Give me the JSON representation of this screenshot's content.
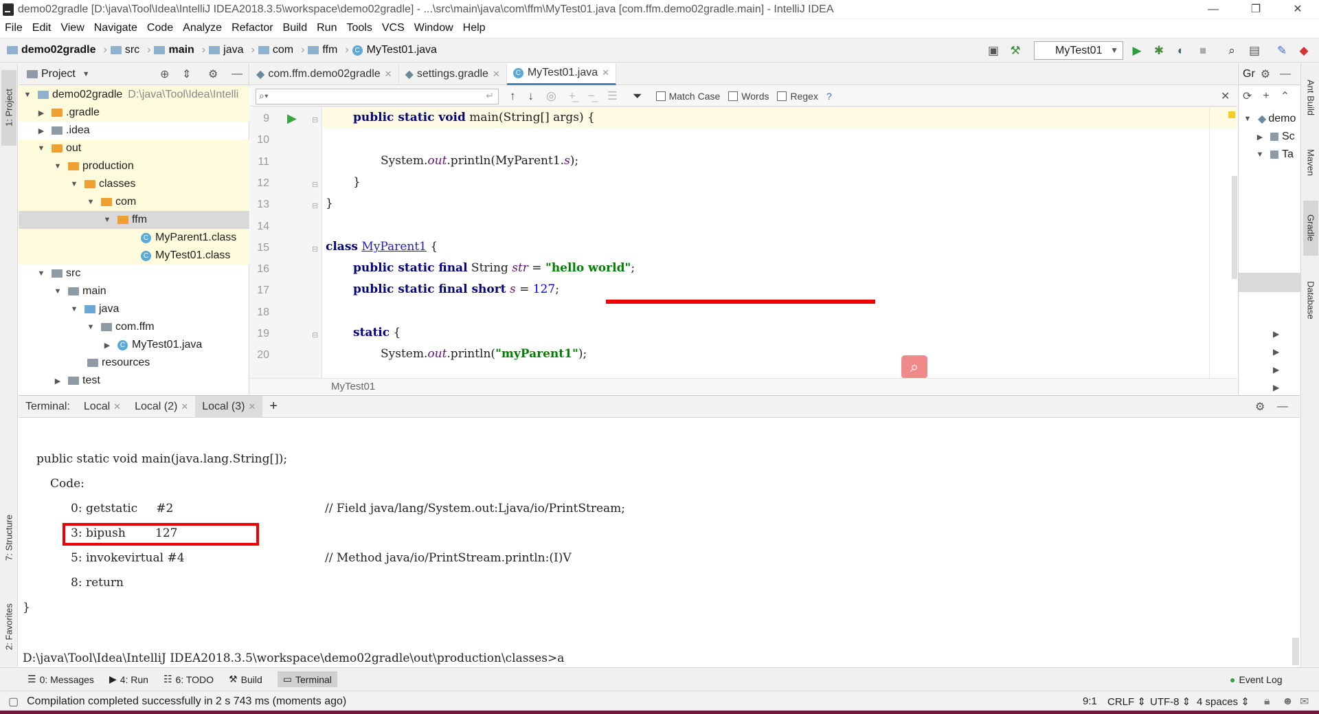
{
  "window": {
    "title": "demo02gradle [D:\\java\\Tool\\Idea\\IntelliJ IDEA2018.3.5\\workspace\\demo02gradle] - ...\\src\\main\\java\\com\\ffm\\MyTest01.java [com.ffm.demo02gradle.main] - IntelliJ IDEA",
    "minimize": "—",
    "restore": "❐",
    "close": "✕"
  },
  "menu": [
    "File",
    "Edit",
    "View",
    "Navigate",
    "Code",
    "Analyze",
    "Refactor",
    "Build",
    "Run",
    "Tools",
    "VCS",
    "Window",
    "Help"
  ],
  "breadcrumbs": [
    "demo02gradle",
    "src",
    "main",
    "java",
    "com",
    "ffm",
    "MyTest01.java"
  ],
  "run_config": "MyTest01",
  "left_stripe": {
    "project": "1: Project",
    "structure": "7: Structure",
    "favorites": "2: Favorites"
  },
  "right_stripe": {
    "ant": "Ant Build",
    "maven": "Maven",
    "gradle": "Gradle",
    "database": "Database"
  },
  "project_panel": {
    "title": "Project",
    "items": [
      {
        "label": "demo02gradle",
        "suffix": "D:\\java\\Tool\\Idea\\Intelli"
      },
      {
        "label": ".gradle"
      },
      {
        "label": ".idea"
      },
      {
        "label": "out"
      },
      {
        "label": "production"
      },
      {
        "label": "classes"
      },
      {
        "label": "com"
      },
      {
        "label": "ffm"
      },
      {
        "label": "MyParent1.class"
      },
      {
        "label": "MyTest01.class"
      },
      {
        "label": "src"
      },
      {
        "label": "main"
      },
      {
        "label": "java"
      },
      {
        "label": "com.ffm"
      },
      {
        "label": "MyTest01.java"
      },
      {
        "label": "resources"
      },
      {
        "label": "test"
      }
    ]
  },
  "editor": {
    "tabs": [
      "com.ffm.demo02gradle",
      "settings.gradle",
      "MyTest01.java"
    ],
    "active_tab": "MyTest01.java",
    "find": {
      "placeholder": "",
      "match_case": "Match Case",
      "words": "Words",
      "regex": "Regex",
      "help": "?"
    },
    "line_numbers": [
      "9",
      "10",
      "11",
      "12",
      "13",
      "14",
      "15",
      "16",
      "17",
      "18",
      "19",
      "20"
    ],
    "code": {
      "l9_kw": "public static void",
      "l9_rest": " main(String[] args) {",
      "l11_a": "System.",
      "l11_out": "out",
      "l11_b": ".println(MyParent1.",
      "l11_s": "s",
      "l11_c": ");",
      "l12": "}",
      "l13": "}",
      "l15_kw": "class",
      "l15_name": "MyParent1",
      "l15_rest": " {",
      "l16_kw": "public static final",
      "l16_type": " String ",
      "l16_var": "str",
      "l16_eq": " = ",
      "l16_str": "\"hello world\"",
      "l16_end": ";",
      "l17_kw": "public static final short",
      "l17_var": "s",
      "l17_eq": " = ",
      "l17_num": "127",
      "l17_end": ";",
      "l19_kw": "static",
      "l19_rest": " {",
      "l20_a": "System.",
      "l20_out": "out",
      "l20_b": ".println(",
      "l20_str": "\"myParent1\"",
      "l20_c": ");"
    },
    "breadcrumb": "MyTest01"
  },
  "gradle_panel": {
    "title": "Gr",
    "items": [
      "demo",
      "Sc",
      "Ta"
    ]
  },
  "terminal": {
    "label": "Terminal:",
    "tabs": [
      "Local",
      "Local (2)",
      "Local (3)"
    ],
    "add": "+",
    "lines": {
      "sig": "public static void main(java.lang.String[]);",
      "code": "Code:",
      "op0": "0: getstatic     #2",
      "cm0": "// Field java/lang/System.out:Ljava/io/PrintStream;",
      "op3": "3: bipush        127",
      "op5": "5: invokevirtual #4",
      "cm5": "// Method java/io/PrintStream.println:(I)V",
      "op8": "8: return",
      "brace": "}",
      "prompt": "D:\\java\\Tool\\Idea\\IntelliJ IDEA2018.3.5\\workspace\\demo02gradle\\out\\production\\classes>a"
    }
  },
  "bottom_tabs": {
    "messages": "0: Messages",
    "run": "4: Run",
    "todo": "6: TODO",
    "build": "Build",
    "terminal": "Terminal",
    "event_log": "Event Log"
  },
  "status": {
    "message": "Compilation completed successfully in 2 s 743 ms (moments ago)",
    "position": "9:1",
    "line_sep": "CRLF",
    "encoding": "UTF-8",
    "indent": "4 spaces"
  },
  "colors": {
    "annotation_red": "#ee0000",
    "accent": "#4083c9"
  }
}
